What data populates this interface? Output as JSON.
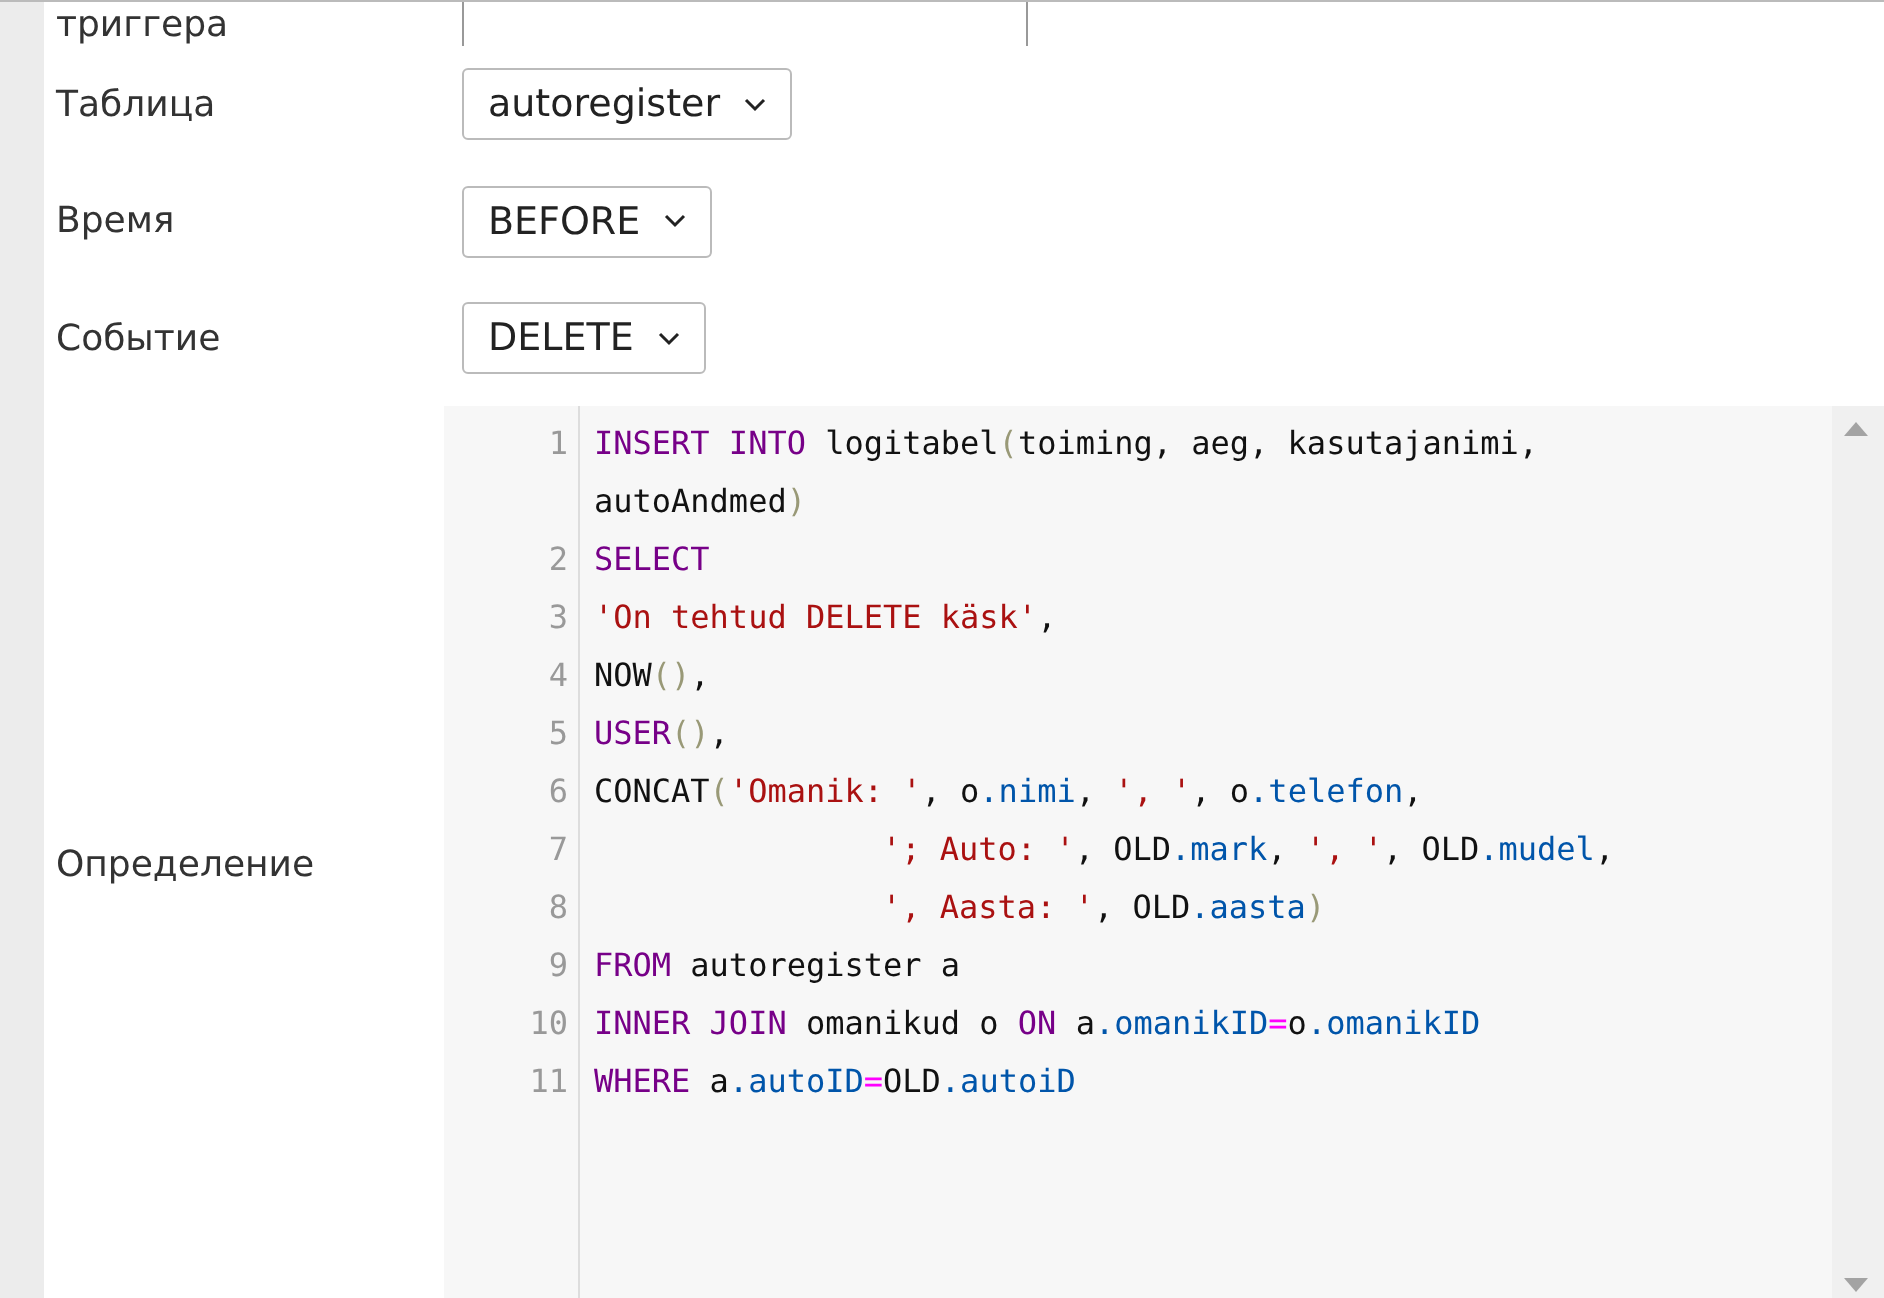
{
  "fields": [
    {
      "label": "триггера",
      "kind": "text"
    },
    {
      "label": "Таблица",
      "kind": "select",
      "value": "autoregister"
    },
    {
      "label": "Время",
      "kind": "select",
      "value": "BEFORE"
    },
    {
      "label": "Событие",
      "kind": "select",
      "value": "DELETE"
    }
  ],
  "definition": {
    "label": "Определение",
    "lines": [
      {
        "number": "1",
        "tokens": [
          {
            "kind": "kw",
            "text": "INSERT INTO"
          },
          {
            "kind": "plain",
            "text": " logitabel"
          },
          {
            "kind": "paren",
            "text": "("
          },
          {
            "kind": "plain",
            "text": "toiming, aeg, kasutajanimi, autoAndmed"
          },
          {
            "kind": "paren",
            "text": ")"
          }
        ]
      },
      {
        "number": "2",
        "tokens": [
          {
            "kind": "kw",
            "text": "SELECT"
          }
        ]
      },
      {
        "number": "3",
        "tokens": [
          {
            "kind": "str",
            "text": "'On tehtud DELETE käsk'"
          },
          {
            "kind": "plain",
            "text": ","
          }
        ]
      },
      {
        "number": "4",
        "tokens": [
          {
            "kind": "plain",
            "text": "NOW"
          },
          {
            "kind": "paren",
            "text": "()"
          },
          {
            "kind": "plain",
            "text": ","
          }
        ]
      },
      {
        "number": "5",
        "tokens": [
          {
            "kind": "kw",
            "text": "USER"
          },
          {
            "kind": "paren",
            "text": "()"
          },
          {
            "kind": "plain",
            "text": ","
          }
        ]
      },
      {
        "number": "6",
        "tokens": [
          {
            "kind": "plain",
            "text": "CONCAT"
          },
          {
            "kind": "paren",
            "text": "("
          },
          {
            "kind": "str",
            "text": "'Omanik: '"
          },
          {
            "kind": "plain",
            "text": ", o"
          },
          {
            "kind": "prop",
            "text": ".nimi"
          },
          {
            "kind": "plain",
            "text": ", "
          },
          {
            "kind": "str",
            "text": "', '"
          },
          {
            "kind": "plain",
            "text": ", o"
          },
          {
            "kind": "prop",
            "text": ".telefon"
          },
          {
            "kind": "plain",
            "text": ","
          }
        ]
      },
      {
        "number": "7",
        "indented": true,
        "tokens": [
          {
            "kind": "str",
            "text": "'; Auto: '"
          },
          {
            "kind": "plain",
            "text": ", OLD"
          },
          {
            "kind": "prop",
            "text": ".mark"
          },
          {
            "kind": "plain",
            "text": ", "
          },
          {
            "kind": "str",
            "text": "', '"
          },
          {
            "kind": "plain",
            "text": ", OLD"
          },
          {
            "kind": "prop",
            "text": ".mudel"
          },
          {
            "kind": "plain",
            "text": ","
          }
        ]
      },
      {
        "number": "8",
        "indented": true,
        "tokens": [
          {
            "kind": "str",
            "text": "', Aasta: '"
          },
          {
            "kind": "plain",
            "text": ", OLD"
          },
          {
            "kind": "prop",
            "text": ".aasta"
          },
          {
            "kind": "paren",
            "text": ")"
          }
        ]
      },
      {
        "number": "9",
        "tokens": [
          {
            "kind": "kw",
            "text": "FROM"
          },
          {
            "kind": "plain",
            "text": " autoregister a"
          }
        ]
      },
      {
        "number": "10",
        "tokens": [
          {
            "kind": "kw",
            "text": "INNER JOIN"
          },
          {
            "kind": "plain",
            "text": " omanikud o "
          },
          {
            "kind": "kw",
            "text": "ON"
          },
          {
            "kind": "plain",
            "text": " a"
          },
          {
            "kind": "prop",
            "text": ".omanikID"
          },
          {
            "kind": "op",
            "text": "="
          },
          {
            "kind": "plain",
            "text": "o"
          },
          {
            "kind": "prop",
            "text": ".omanikID"
          }
        ]
      },
      {
        "number": "11",
        "tokens": [
          {
            "kind": "kw",
            "text": "WHERE"
          },
          {
            "kind": "plain",
            "text": " a"
          },
          {
            "kind": "prop",
            "text": ".autoID"
          },
          {
            "kind": "op",
            "text": "="
          },
          {
            "kind": "plain",
            "text": "OLD"
          },
          {
            "kind": "prop",
            "text": ".autoiD"
          }
        ]
      }
    ]
  }
}
